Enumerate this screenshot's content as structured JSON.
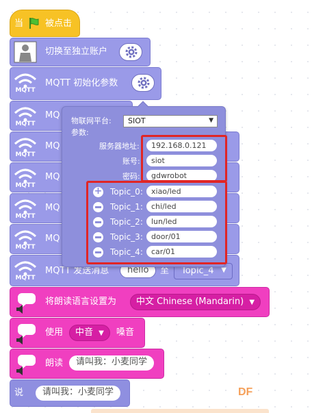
{
  "hat_block": {
    "prefix": "当",
    "suffix": "被点击"
  },
  "switch_account_block": {
    "label": "切换至独立账户"
  },
  "mqtt_init_block": {
    "label": "MQTT 初始化参数"
  },
  "mqtt_logo_text": "MQTT",
  "partial_blocks": {
    "prefix": "MQ"
  },
  "popup": {
    "platform_label": "物联网平台:",
    "platform_value": "SIOT",
    "params_label": "参数:",
    "server_label": "服务器地址:",
    "server_value": "192.168.0.121",
    "account_label": "账号:",
    "account_value": "siot",
    "password_label": "密码:",
    "password_value": "gdwrobot",
    "topics": [
      {
        "label": "Topic_0:",
        "value": "xiao/led"
      },
      {
        "label": "Topic_1:",
        "value": "chi/led"
      },
      {
        "label": "Topic_2:",
        "value": "lun/led"
      },
      {
        "label": "Topic_3:",
        "value": "door/01"
      },
      {
        "label": "Topic_4:",
        "value": "car/01"
      }
    ]
  },
  "mqtt_send_block": {
    "label": "MQTT 发送消息",
    "message": "hello",
    "to_label": "至",
    "topic": "Topic_4"
  },
  "set_voice_block": {
    "label": "将朗读语言设置为",
    "language": "中文 Chinese (Mandarin)"
  },
  "use_voice_block": {
    "prefix": "使用",
    "voice": "中音",
    "suffix": "嗓音"
  },
  "speak_block": {
    "label": "朗读",
    "text": "请叫我：小麦同学"
  },
  "say_block": {
    "label": "说",
    "text": "请叫我：小麦同学"
  },
  "watermark": "DF",
  "colors": {
    "mqtt": "#9a9ae8",
    "tts": "#f03fc0",
    "event": "#f7c225",
    "highlight": "#e12525"
  }
}
